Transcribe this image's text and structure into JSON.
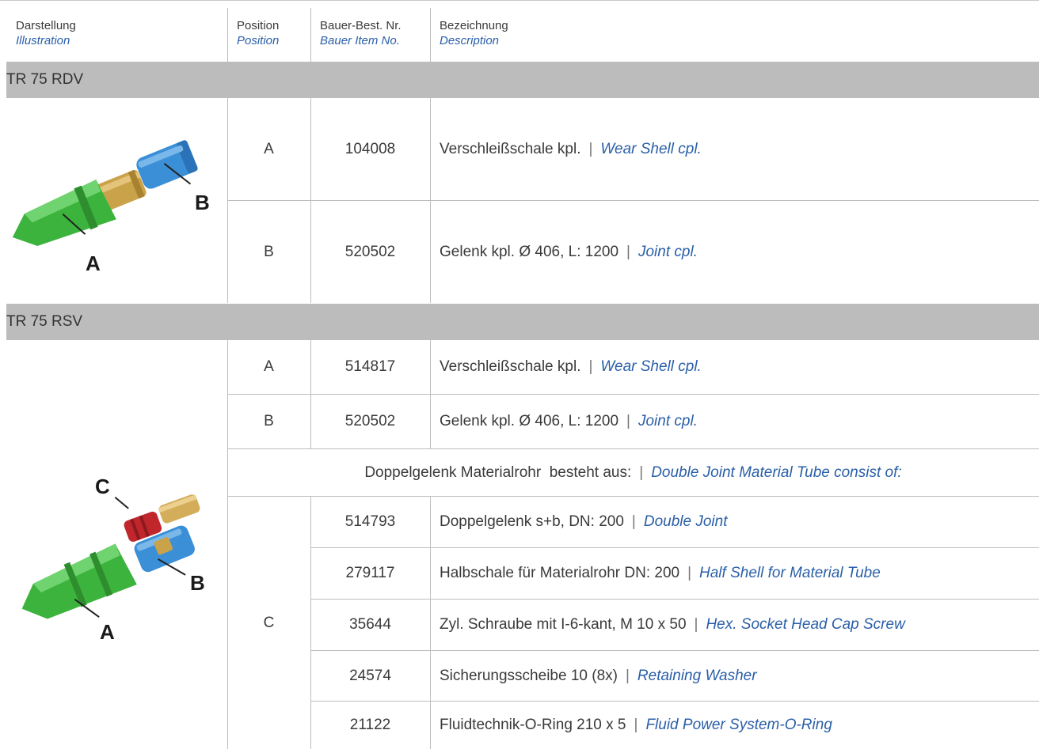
{
  "header": {
    "illustration_de": "Darstellung",
    "illustration_en": "Illustration",
    "position_de": "Position",
    "position_en": "Position",
    "item_de": "Bauer-Best. Nr.",
    "item_en": "Bauer Item No.",
    "desc_de": "Bezeichnung",
    "desc_en": "Description"
  },
  "sections": [
    {
      "title": "TR 75 RDV",
      "labels": [
        "A",
        "B"
      ],
      "rows": [
        {
          "pos": "A",
          "item": "104008",
          "de": "Verschleißschale kpl.",
          "en": "Wear Shell cpl."
        },
        {
          "pos": "B",
          "item": "520502",
          "de": "Gelenk kpl. Ø 406, L: 1200",
          "en": "Joint cpl."
        }
      ]
    },
    {
      "title": "TR 75 RSV",
      "labels": [
        "A",
        "B",
        "C"
      ],
      "rows": [
        {
          "pos": "A",
          "item": "514817",
          "de": "Verschleißschale kpl.",
          "en": "Wear Shell cpl."
        },
        {
          "pos": "B",
          "item": "520502",
          "de": "Gelenk kpl. Ø 406, L: 1200",
          "en": "Joint cpl."
        }
      ],
      "group": {
        "de": "Doppelgelenk Materialrohr  besteht aus:",
        "en": "Double Joint Material Tube consist of:"
      },
      "group_pos": "C",
      "group_rows": [
        {
          "item": "514793",
          "de": "Doppelgelenk s+b, DN: 200",
          "en": "Double Joint"
        },
        {
          "item": "279117",
          "de": "Halbschale für Materialrohr DN: 200",
          "en": "Half Shell for Material Tube"
        },
        {
          "item": "35644",
          "de": "Zyl. Schraube mit I-6-kant, M 10 x 50",
          "en": "Hex. Socket Head Cap Screw"
        },
        {
          "item": "24574",
          "de": "Sicherungsscheibe 10 (8x)",
          "en": "Retaining Washer"
        },
        {
          "item": "21122",
          "de": "Fluidtechnik-O-Ring 210 x 5",
          "en": "Fluid Power System-O-Ring"
        }
      ]
    }
  ],
  "separator": "|",
  "colors": {
    "band": "#bcbcbc",
    "english_text": "#2a5fa8",
    "shell": "#3cb33c",
    "joint": "#3b8fd6",
    "tube": "#c9a24a",
    "ring": "#c0262b"
  }
}
